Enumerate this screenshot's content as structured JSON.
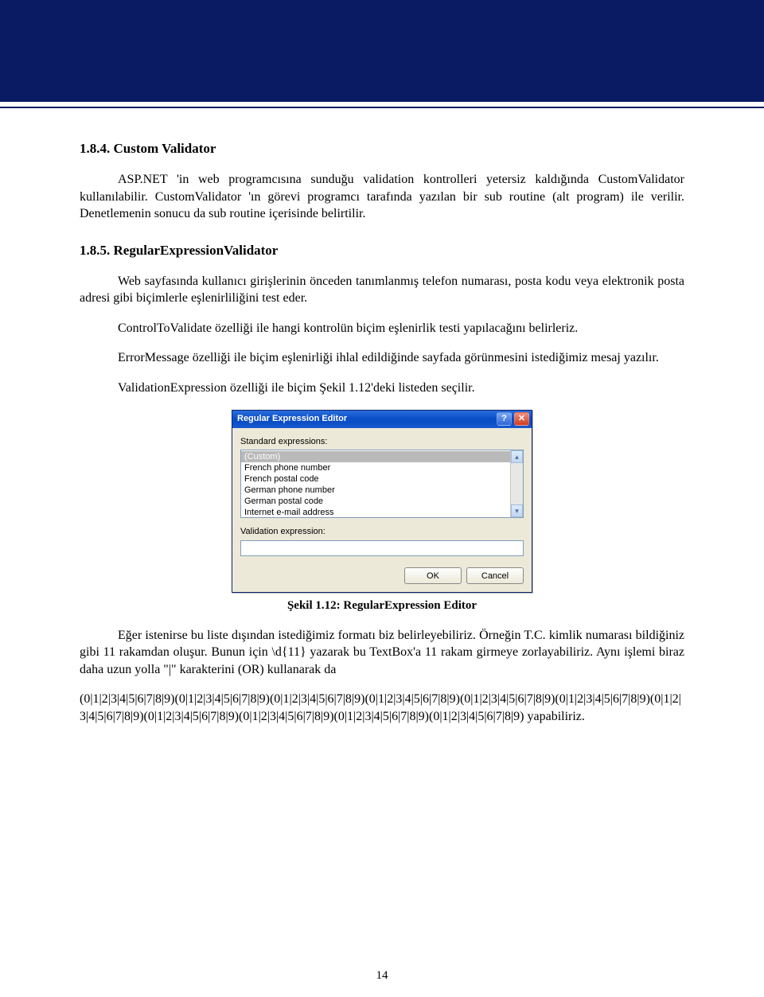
{
  "section184": {
    "number_title": "1.8.4. Custom Validator",
    "p1": "ASP.NET 'in web programcısına sunduğu validation kontrolleri yetersiz kaldığında CustomValidator kullanılabilir. CustomValidator 'ın görevi programcı tarafında yazılan bir sub routine (alt program) ile verilir. Denetlemenin sonucu da sub routine içerisinde belirtilir."
  },
  "section185": {
    "number_title": "1.8.5. RegularExpressionValidator",
    "p1": "Web sayfasında kullanıcı girişlerinin önceden tanımlanmış telefon numarası, posta kodu veya elektronik posta adresi gibi biçimlerle eşlenirliliğini test eder.",
    "p2": "ControlToValidate özelliği ile hangi kontrolün biçim eşlenirlik testi yapılacağını belirleriz.",
    "p3": "ErrorMessage özelliği ile biçim eşlenirliği ihlal edildiğinde sayfada görünmesini istediğimiz mesaj yazılır.",
    "p4": "ValidationExpression özelliği ile biçim Şekil 1.12'deki listeden seçilir.",
    "caption": "Şekil 1.12: RegularExpression Editor",
    "p5": "Eğer istenirse bu liste dışından istediğimiz formatı biz belirleyebiliriz. Örneğin T.C. kimlik numarası bildiğiniz gibi 11 rakamdan oluşur. Bunun için \\d{11} yazarak bu TextBox'a 11 rakam girmeye zorlayabiliriz. Aynı işlemi biraz daha uzun yolla \"|\" karakterini (OR) kullanarak da",
    "p6": "(0|1|2|3|4|5|6|7|8|9)(0|1|2|3|4|5|6|7|8|9)(0|1|2|3|4|5|6|7|8|9)(0|1|2|3|4|5|6|7|8|9)(0|1|2|3|4|5|6|7|8|9)(0|1|2|3|4|5|6|7|8|9)(0|1|2|3|4|5|6|7|8|9)(0|1|2|3|4|5|6|7|8|9)(0|1|2|3|4|5|6|7|8|9)(0|1|2|3|4|5|6|7|8|9)(0|1|2|3|4|5|6|7|8|9) yapabiliriz."
  },
  "dialog": {
    "title": "Regular Expression Editor",
    "label_std": "Standard expressions:",
    "items": [
      "(Custom)",
      "French phone number",
      "French postal code",
      "German phone number",
      "German postal code",
      "Internet e-mail address"
    ],
    "label_expr": "Validation expression:",
    "expr_value": "",
    "ok": "OK",
    "cancel": "Cancel",
    "help_symbol": "?",
    "close_symbol": "✕",
    "up_symbol": "▴",
    "down_symbol": "▾"
  },
  "page_number": "14"
}
